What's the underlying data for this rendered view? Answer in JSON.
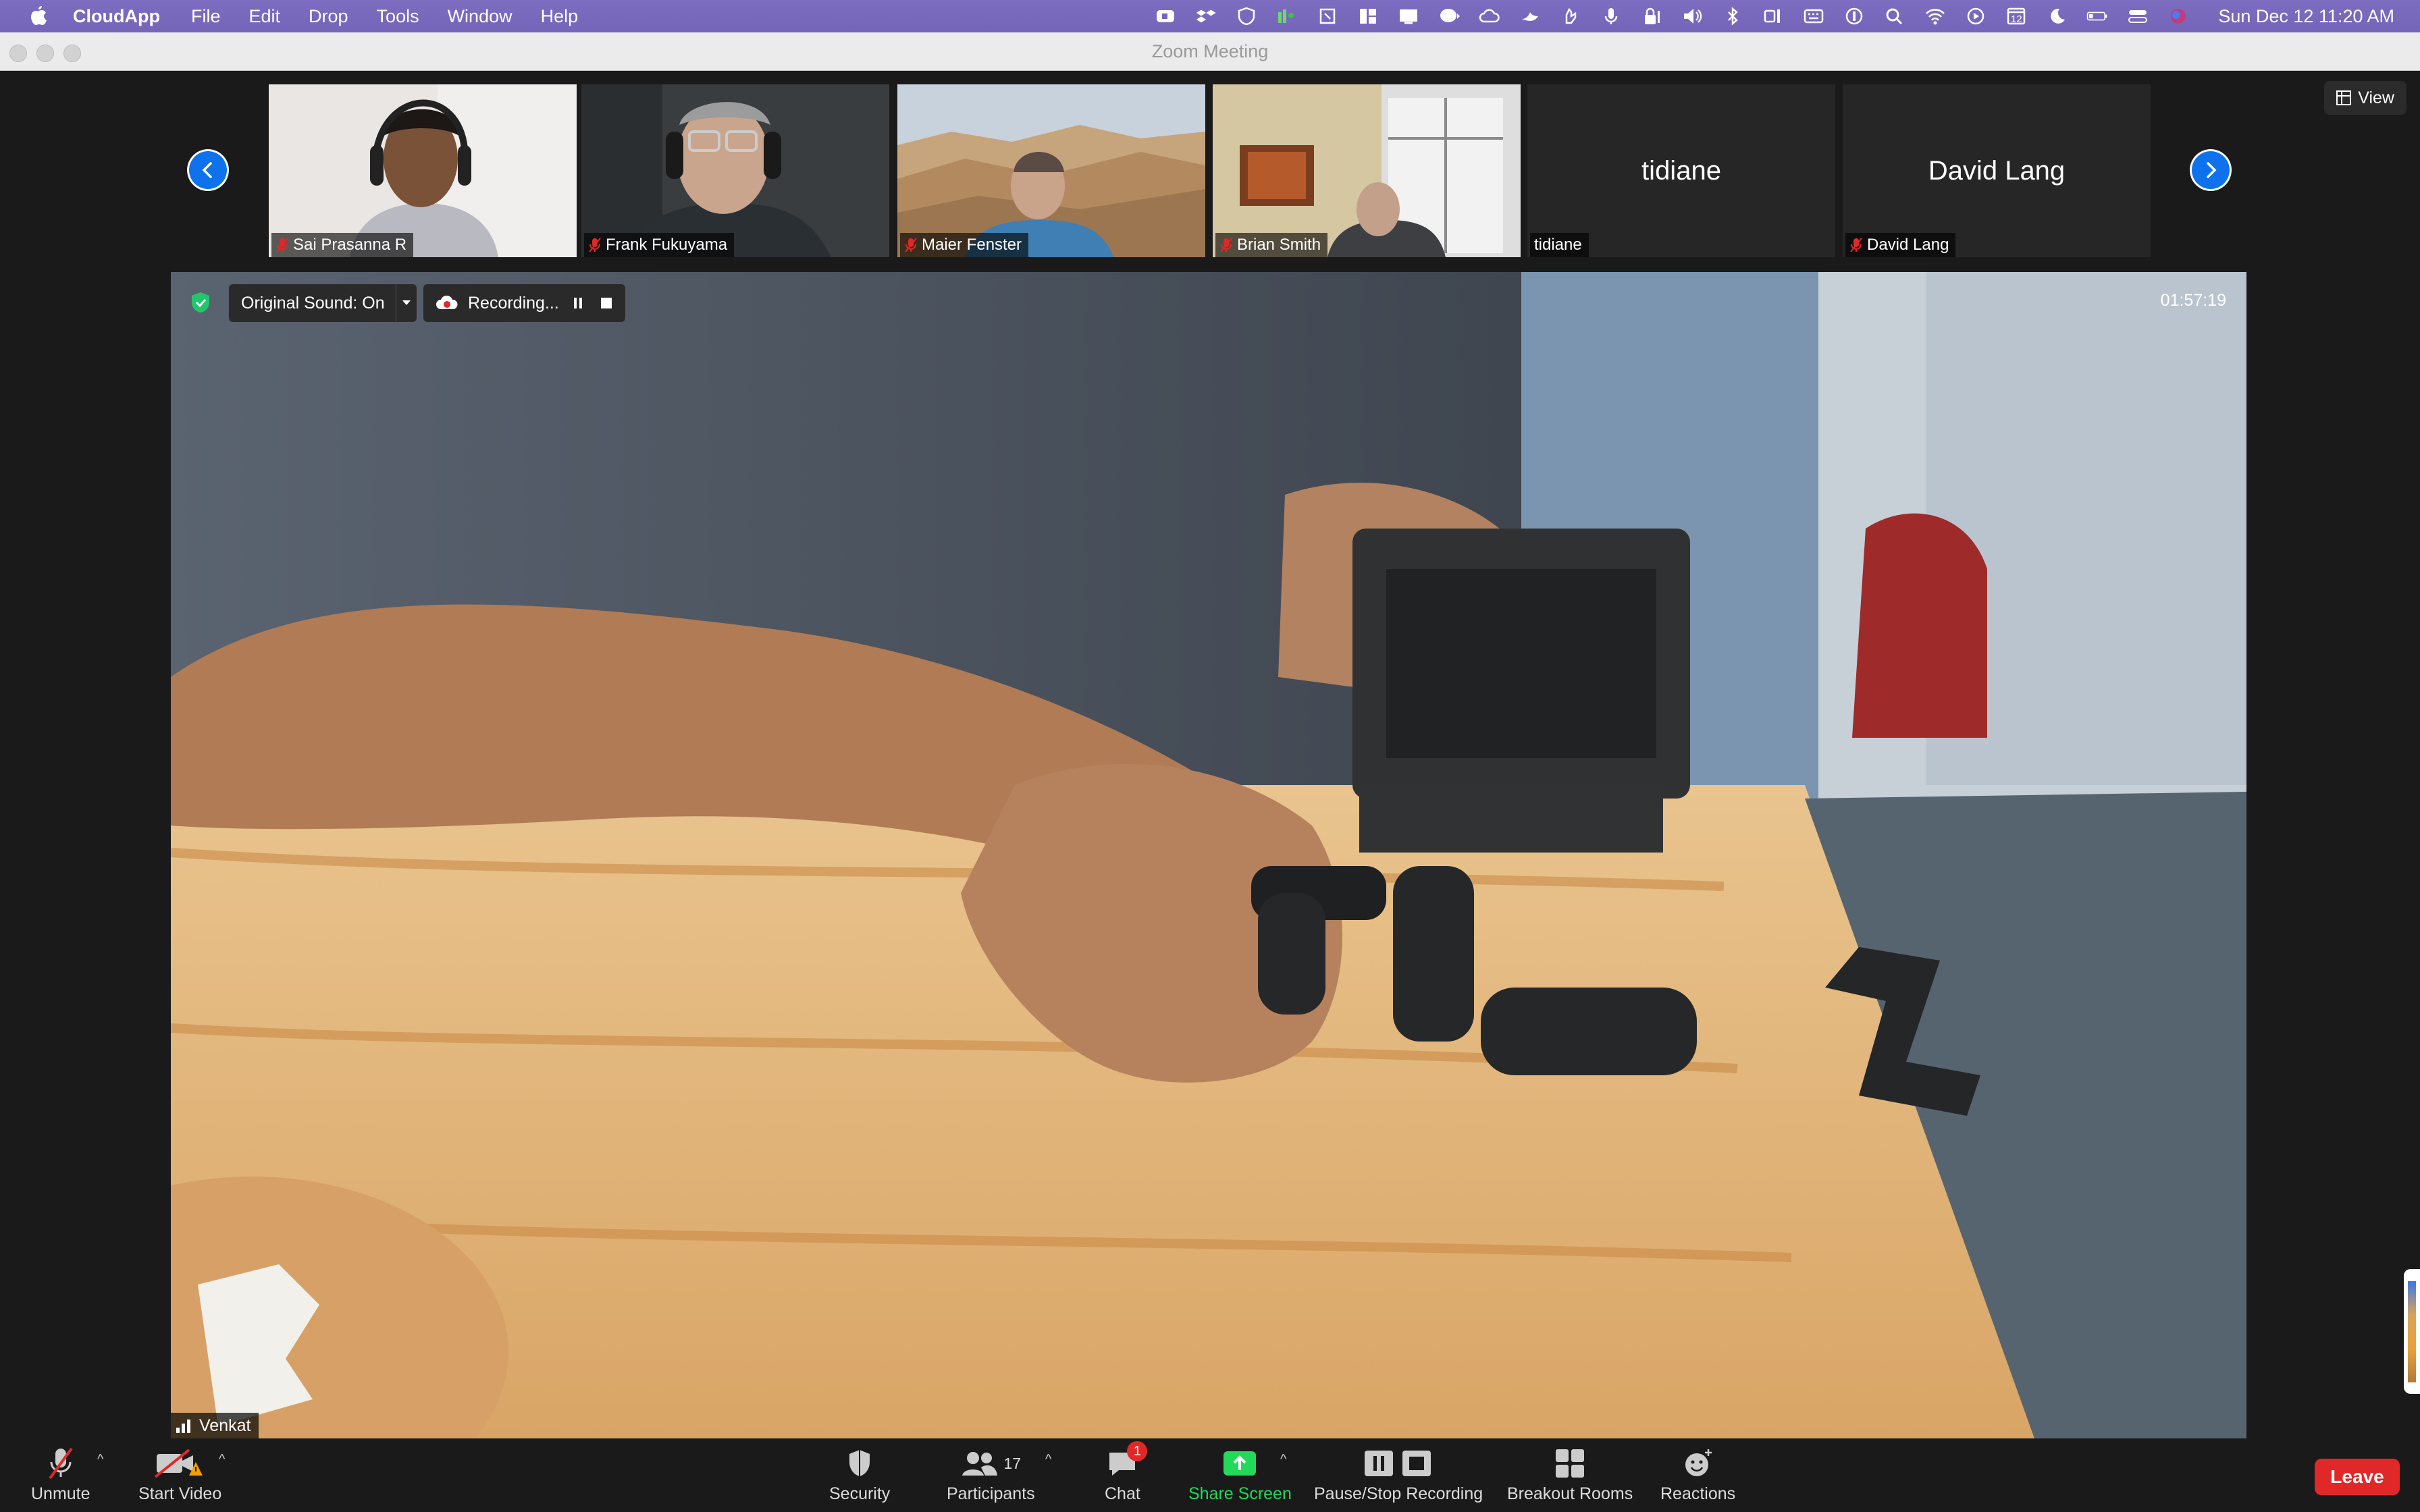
{
  "menubar": {
    "app_name": "CloudApp",
    "items": [
      "File",
      "Edit",
      "Drop",
      "Tools",
      "Window",
      "Help"
    ],
    "clock": "Sun Dec 12  11:20 AM",
    "calendar_day": "12"
  },
  "window": {
    "title": "Zoom Meeting"
  },
  "view_button": {
    "label": "View"
  },
  "thumbnails": [
    {
      "name": "Sai Prasanna R",
      "muted": true,
      "has_video": true
    },
    {
      "name": "Frank Fukuyama",
      "muted": true,
      "has_video": true
    },
    {
      "name": "Maier Fenster",
      "muted": true,
      "has_video": true
    },
    {
      "name": "Brian Smith",
      "muted": true,
      "has_video": true
    },
    {
      "name": "tidiane",
      "display_name": "tidiane",
      "muted": false,
      "has_video": false
    },
    {
      "name": "David Lang",
      "display_name": "David Lang",
      "muted": true,
      "has_video": false
    }
  ],
  "main_video": {
    "speaker": "Venkat",
    "original_sound": "Original Sound: On",
    "recording": "Recording...",
    "timer": "01:57:19"
  },
  "toolbar": {
    "unmute": "Unmute",
    "start_video": "Start Video",
    "security": "Security",
    "participants": "Participants",
    "participants_count": "17",
    "chat": "Chat",
    "chat_badge": "1",
    "share_screen": "Share Screen",
    "pause_stop_recording": "Pause/Stop Recording",
    "breakout_rooms": "Breakout Rooms",
    "reactions": "Reactions",
    "leave": "Leave"
  },
  "colors": {
    "menubar": "#7565ba",
    "accent_blue": "#0e72ed",
    "share_green": "#23d959",
    "leave_red": "#e02828",
    "mute_red": "#e02828"
  }
}
